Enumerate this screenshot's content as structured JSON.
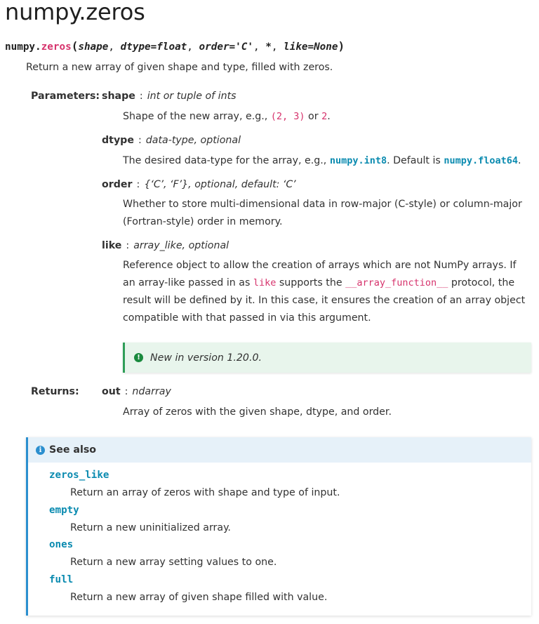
{
  "title": "numpy.zeros",
  "signature": {
    "prename": "numpy.",
    "name": "zeros",
    "open_paren": "(",
    "close_paren": ")",
    "params": [
      "shape",
      "dtype=float",
      "order='C'",
      "*",
      "like=None"
    ]
  },
  "summary": "Return a new array of given shape and type, filled with zeros.",
  "parameters_label": "Parameters:",
  "parameters": [
    {
      "name": "shape",
      "sep": ":",
      "type": "int or tuple of ints",
      "desc_pre": "Shape of the new array, e.g., ",
      "code1": "(2, 3)",
      "desc_mid": " or ",
      "code2": "2",
      "desc_post": "."
    },
    {
      "name": "dtype",
      "sep": ":",
      "type": "data-type, optional",
      "desc_pre": "The desired data-type for the array, e.g., ",
      "link1": "numpy.int8",
      "desc_mid": ". Default is ",
      "link2": "numpy.float64",
      "desc_post": "."
    },
    {
      "name": "order",
      "sep": ":",
      "type": "{‘C’, ‘F’}, optional, default: ‘C’",
      "desc": "Whether to store multi-dimensional data in row-major (C-style) or column-major (Fortran-style) order in memory."
    },
    {
      "name": "like",
      "sep": ":",
      "type": "array_like, optional",
      "desc_pre": "Reference object to allow the creation of arrays which are not NumPy arrays. If an array-like passed in as ",
      "code1": "like",
      "desc_mid": " supports the ",
      "code2": "__array_function__",
      "desc_post": " protocol, the result will be defined by it. In this case, it ensures the creation of an array object compatible with that passed in via this argument."
    }
  ],
  "versionadded": "New in version 1.20.0.",
  "returns_label": "Returns:",
  "returns": {
    "name": "out",
    "sep": ":",
    "type": "ndarray",
    "desc": "Array of zeros with the given shape, dtype, and order."
  },
  "seealso": {
    "title": "See also",
    "items": [
      {
        "name": "zeros_like",
        "desc": "Return an array of zeros with shape and type of input."
      },
      {
        "name": "empty",
        "desc": "Return a new uninitialized array."
      },
      {
        "name": "ones",
        "desc": "Return a new array setting values to one."
      },
      {
        "name": "full",
        "desc": "Return a new array of given shape filled with value."
      }
    ]
  },
  "icons": {
    "versionadded": "exclamation-circle-icon",
    "seealso": "info-circle-icon"
  },
  "colors": {
    "code_pink": "#d6336c",
    "link_teal": "#0b8bb0",
    "version_green": "#2f9e58",
    "seealso_blue": "#2b8fcf"
  }
}
